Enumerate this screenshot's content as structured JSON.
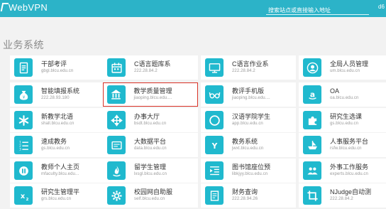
{
  "header": {
    "logo_text": "WebVPN",
    "search_placeholder": "搜索站点或直接输入地址",
    "user_text": "d6"
  },
  "section_title": "业务系统",
  "highlight_color": "#d93025",
  "accent_color": "#2cb3c8",
  "apps": [
    {
      "name": "干部考评",
      "url": "gbgl.blcu.edu.cn",
      "icon": "document-icon"
    },
    {
      "name": "C语言题库系",
      "url": "222.28.84.2",
      "icon": "calendar-icon"
    },
    {
      "name": "C语言作业系",
      "url": "222.28.84.2",
      "icon": "monitor-icon"
    },
    {
      "name": "全局人员管理",
      "url": "um.blcu.edu.cn",
      "icon": "user-icon"
    },
    {
      "name": "智能填报系统",
      "url": "222.28.93.180",
      "icon": "money-bag-icon"
    },
    {
      "name": "教学质量管理",
      "url": "jiaoping.blcu.edu....",
      "icon": "bank-icon"
    },
    {
      "name": "教评手机版",
      "url": "jiaoping.blcu.edu....",
      "icon": "glasses-icon"
    },
    {
      "name": "OA",
      "url": "oa.blcu.edu.cn",
      "icon": "amazon-icon"
    },
    {
      "name": "新教学北语",
      "url": "shall.blcu.edu.cn",
      "icon": "asterisk-icon"
    },
    {
      "name": "办事大厅",
      "url": "bsdt.blcu.edu.cn",
      "icon": "move-arrows-icon"
    },
    {
      "name": "汉语学院学生",
      "url": "app.blcu.edu.cn",
      "icon": "circle-icon"
    },
    {
      "name": "研究生选课",
      "url": "gs.blcu.edu.cn",
      "icon": "puzzle-icon"
    },
    {
      "name": "速成教务",
      "url": "gs.blcu.edu.cn",
      "icon": "ordered-list-icon"
    },
    {
      "name": "大数据平台",
      "url": "data.blcu.edu.cn",
      "icon": "database-icon"
    },
    {
      "name": "教务系统",
      "url": "jwxt.blcu.edu.cn",
      "icon": "y-logo-icon"
    },
    {
      "name": "人事服务平台",
      "url": "rsfw.blcu.edu.cn",
      "icon": "ship-icon"
    },
    {
      "name": "教师个人主页",
      "url": "mfaculty.blcu.edu...",
      "icon": "pause-icon"
    },
    {
      "name": "留学生管理",
      "url": "lxsgl.blcu.edu.cn",
      "icon": "flame-icon"
    },
    {
      "name": "图书馆座位预",
      "url": "libkjyy.blcu.edu.cn",
      "icon": "indent-icon"
    },
    {
      "name": "外事工作服务",
      "url": "experts.blcu.edu.cn",
      "icon": "group-icon"
    },
    {
      "name": "研究生管理平",
      "url": "grs.blcu.edu.cn",
      "icon": "subscript-icon"
    },
    {
      "name": "校园网自助服",
      "url": "self.blcu.edu.cn",
      "icon": "gear-icon"
    },
    {
      "name": "财务查询",
      "url": "222.28.94.26",
      "icon": "invoice-icon"
    },
    {
      "name": "NJudge自动测",
      "url": "222.28.84.2",
      "icon": "crop-icon"
    }
  ]
}
